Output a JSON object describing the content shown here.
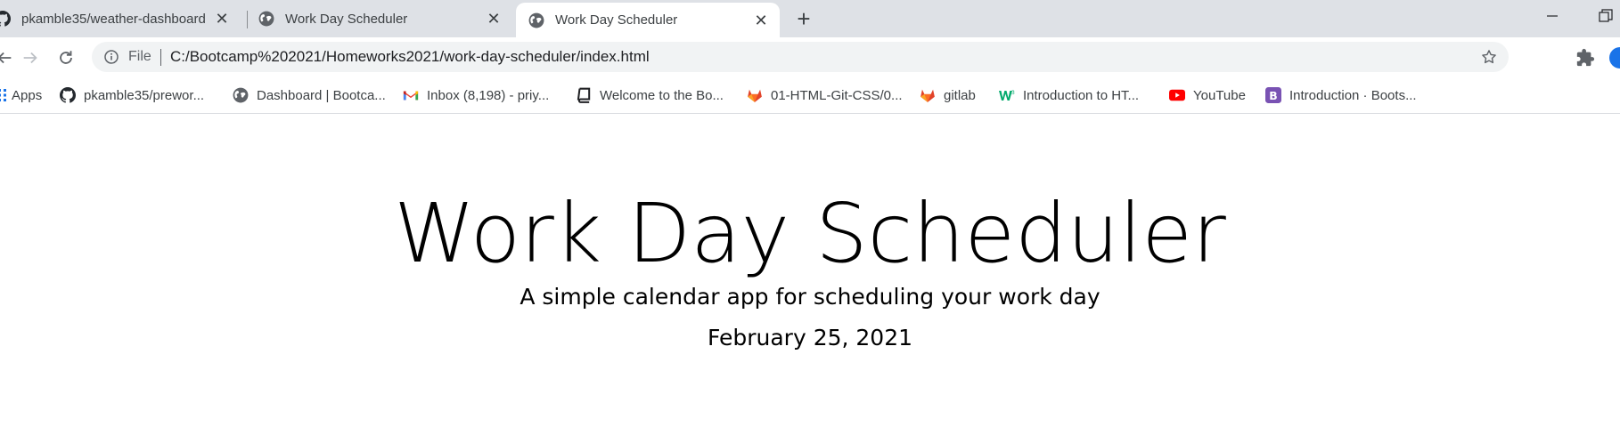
{
  "browser": {
    "tabs": [
      {
        "label": "pkamble35/weather-dashboard",
        "icon": "github-icon",
        "active": false
      },
      {
        "label": "Work Day Scheduler",
        "icon": "globe-icon",
        "active": false
      },
      {
        "label": "Work Day Scheduler",
        "icon": "globe-icon",
        "active": true
      }
    ],
    "address": {
      "scheme_label": "File",
      "url": "C:/Bootcamp%202021/Homeworks2021/work-day-scheduler/index.html"
    },
    "bookmarks": [
      {
        "label": "Apps",
        "icon": "apps-grid-icon"
      },
      {
        "label": "pkamble35/prewor...",
        "icon": "github-icon"
      },
      {
        "label": "Dashboard | Bootca...",
        "icon": "globe-icon"
      },
      {
        "label": "Inbox (8,198) - priy...",
        "icon": "gmail-icon"
      },
      {
        "label": "Welcome to the Bo...",
        "icon": "book-icon"
      },
      {
        "label": "01-HTML-Git-CSS/0...",
        "icon": "gitlab-icon"
      },
      {
        "label": "gitlab",
        "icon": "gitlab-icon"
      },
      {
        "label": "Introduction to HT...",
        "icon": "w3schools-icon"
      },
      {
        "label": "YouTube",
        "icon": "youtube-icon"
      },
      {
        "label": "Introduction · Boots...",
        "icon": "bootstrap-icon"
      }
    ]
  },
  "page": {
    "title": "Work Day Scheduler",
    "subtitle": "A simple calendar app for scheduling your work day",
    "current_date": "February 25, 2021"
  },
  "colors": {
    "tabstrip": "#dee1e6",
    "omnibox": "#f1f3f4",
    "gitlab": "#e24329",
    "youtube": "#ff0000",
    "bootstrap": "#7952b3",
    "w3schools": "#04aa6d"
  }
}
